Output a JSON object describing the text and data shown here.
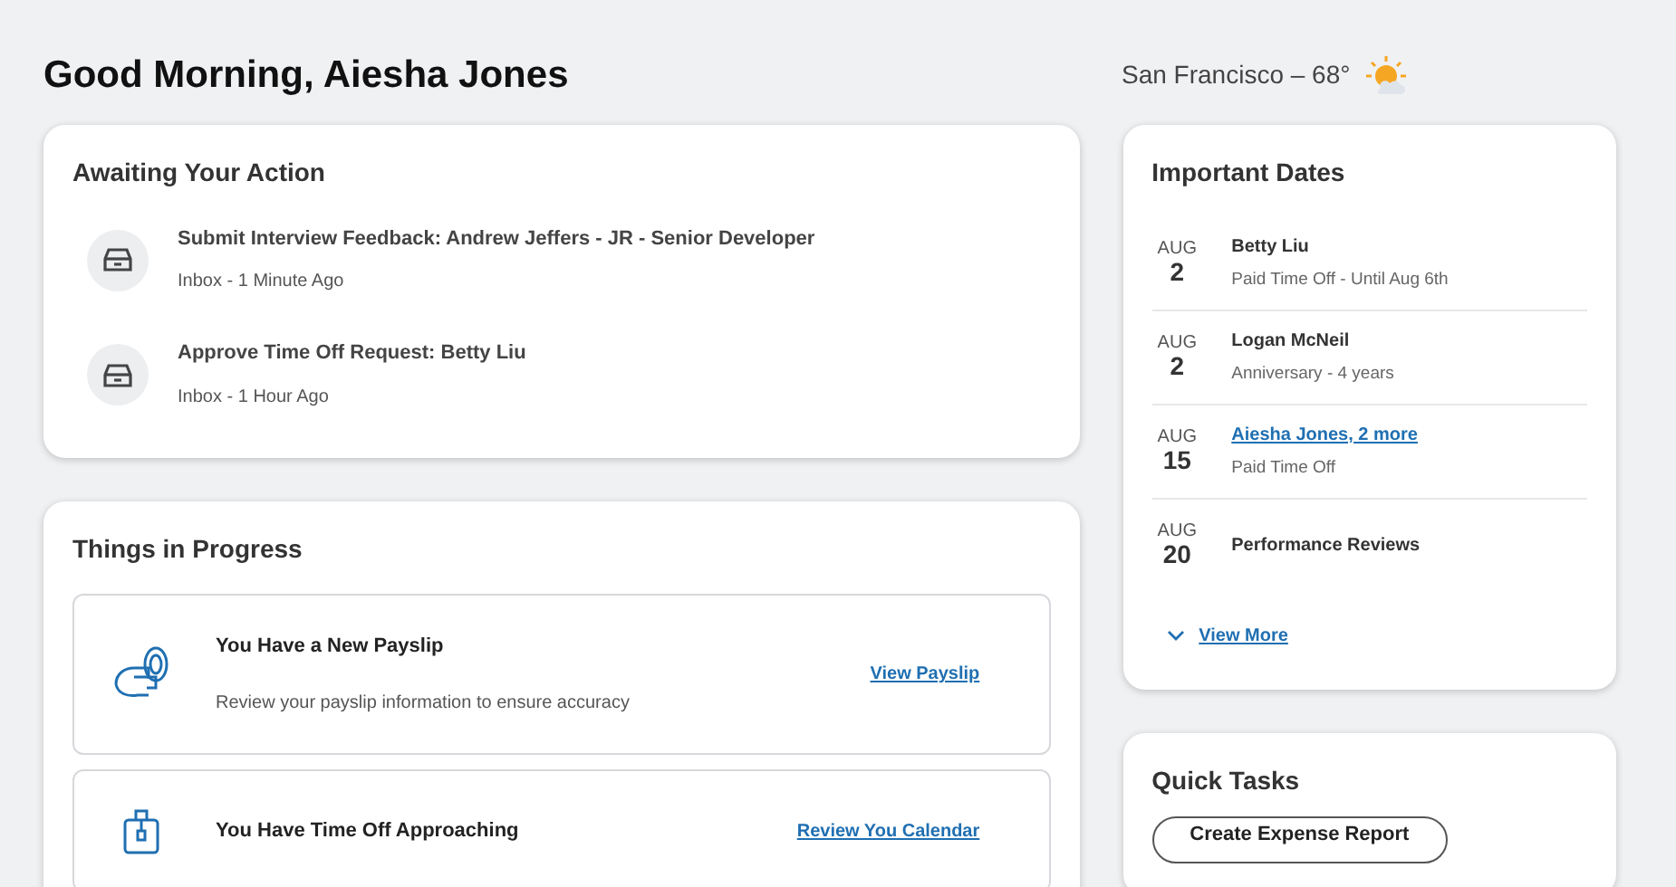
{
  "greeting": "Good Morning, Aiesha Jones",
  "weather": {
    "location": "San Francisco – 68°"
  },
  "awaiting": {
    "title": "Awaiting Your Action",
    "items": [
      {
        "title": "Submit Interview Feedback: Andrew Jeffers - JR - Senior Developer",
        "meta": "Inbox - 1 Minute Ago"
      },
      {
        "title": "Approve Time Off Request: Betty Liu",
        "meta": "Inbox - 1 Hour Ago"
      }
    ]
  },
  "progress": {
    "title": "Things in Progress",
    "items": [
      {
        "kind": "payslip",
        "title": "You Have a New Payslip",
        "description": "Review your payslip information to ensure accuracy",
        "action": "View Payslip"
      },
      {
        "kind": "timeoff",
        "title": "You Have Time Off Approaching",
        "action": "Review You Calendar"
      }
    ]
  },
  "dates": {
    "title": "Important Dates",
    "items": [
      {
        "month": "AUG",
        "day": "2",
        "name": "Betty Liu",
        "link": false,
        "detail": "Paid Time Off - Until Aug 6th"
      },
      {
        "month": "AUG",
        "day": "2",
        "name": "Logan McNeil",
        "link": false,
        "detail": "Anniversary - 4 years"
      },
      {
        "month": "AUG",
        "day": "15",
        "name": "Aiesha Jones, 2 more",
        "link": true,
        "detail": "Paid Time Off"
      },
      {
        "month": "AUG",
        "day": "20",
        "name": "Performance Reviews",
        "link": false
      }
    ],
    "more": "View More"
  },
  "quick_tasks": {
    "title": "Quick Tasks",
    "buttons": [
      "Create Expense Report"
    ]
  }
}
